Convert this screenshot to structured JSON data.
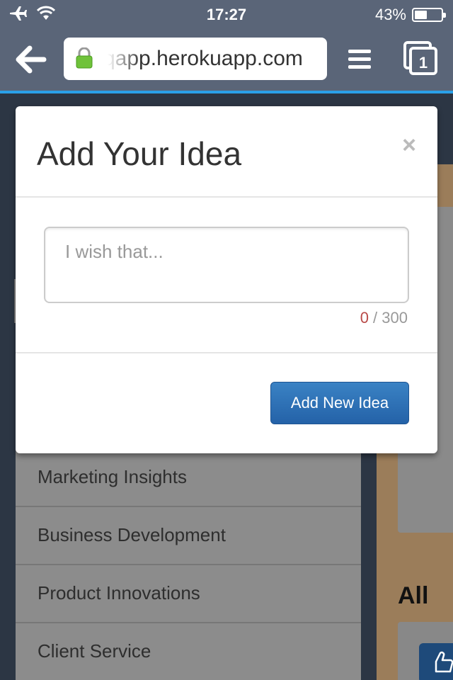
{
  "status_bar": {
    "time": "17:27",
    "battery_label": "43%",
    "battery_level": 0.43
  },
  "browser": {
    "url": "qapp.herokuapp.com",
    "icons": [
      "back-arrow-icon",
      "lock-icon",
      "menu-icon",
      "tabs-icon"
    ],
    "tab_count": "1"
  },
  "modal": {
    "title": "Add Your Idea",
    "close_label": "×",
    "input_placeholder": "I wish that...",
    "input_value": "",
    "char_count": "0",
    "char_separator": " / ",
    "char_max": "300",
    "submit_label": "Add New Idea"
  },
  "background_page": {
    "categories": [
      "Marketing Insights",
      "Business Development",
      "Product Innovations",
      "Client Service"
    ],
    "section_label": "All"
  },
  "colors": {
    "toolbar": "#5a6578",
    "accent": "#2462a8",
    "counter_zero": "#b94a48"
  }
}
